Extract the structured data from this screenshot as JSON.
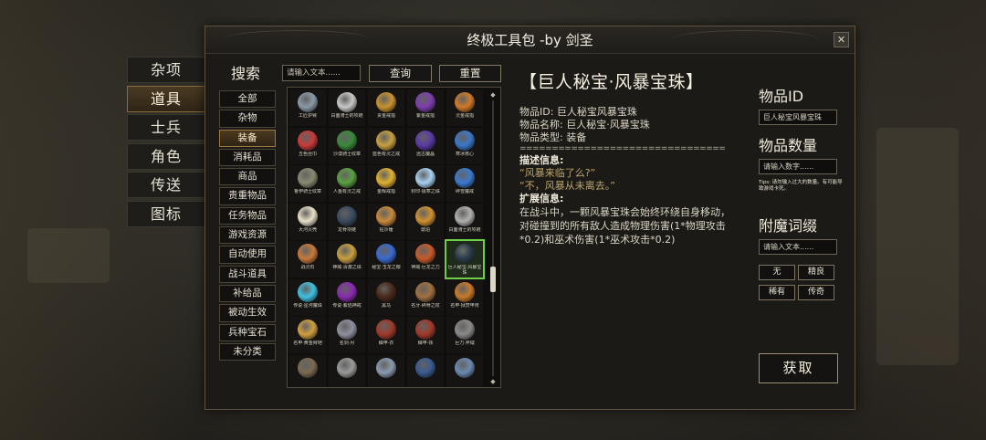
{
  "window": {
    "title": "终极工具包 -by 剑圣",
    "close": "✕"
  },
  "sidemenu": [
    {
      "label": "杂项",
      "active": false
    },
    {
      "label": "道具",
      "active": true
    },
    {
      "label": "士兵",
      "active": false
    },
    {
      "label": "角色",
      "active": false
    },
    {
      "label": "传送",
      "active": false
    },
    {
      "label": "图标",
      "active": false
    }
  ],
  "search": {
    "title": "搜索",
    "placeholder": "请输入文本......",
    "query_label": "查询",
    "reset_label": "重置"
  },
  "categories": [
    {
      "label": "全部",
      "active": false
    },
    {
      "label": "杂物",
      "active": false
    },
    {
      "label": "装备",
      "active": true
    },
    {
      "label": "消耗品",
      "active": false
    },
    {
      "label": "商品",
      "active": false
    },
    {
      "label": "贵重物品",
      "active": false
    },
    {
      "label": "任务物品",
      "active": false
    },
    {
      "label": "游戏资源",
      "active": false
    },
    {
      "label": "自动使用",
      "active": false
    },
    {
      "label": "战斗道具",
      "active": false
    },
    {
      "label": "补给品",
      "active": false
    },
    {
      "label": "被动生效",
      "active": false
    },
    {
      "label": "兵种宝石",
      "active": false
    },
    {
      "label": "未分类",
      "active": false
    }
  ],
  "items": [
    {
      "name": "工匠护臂",
      "color": "#8a9aa8"
    },
    {
      "name": "白面骑士的项链",
      "color": "#c8c8c8"
    },
    {
      "name": "贵金戒指",
      "color": "#c8932e"
    },
    {
      "name": "紫金戒指",
      "color": "#7d3fb0"
    },
    {
      "name": "灵金戒指",
      "color": "#d07a2a"
    },
    {
      "name": "五色丝巾",
      "color": "#c83a3a"
    },
    {
      "name": "沙漠骑士纹章",
      "color": "#3a8a3a"
    },
    {
      "name": "蓝色有灵之戒",
      "color": "#c8a040"
    },
    {
      "name": "远古魔晶",
      "color": "#5a3aa8"
    },
    {
      "name": "寒冰核心",
      "color": "#3a78c8"
    },
    {
      "name": "鲁伊骑士纹章",
      "color": "#8a8a70"
    },
    {
      "name": "人鱼有灵之戒",
      "color": "#5aa040"
    },
    {
      "name": "金辉戒指",
      "color": "#e0b030"
    },
    {
      "name": "封印·极寒之珠",
      "color": "#a8d0f0"
    },
    {
      "name": "碎雪魔戒",
      "color": "#3a7ad0"
    },
    {
      "name": "大河贝壳",
      "color": "#e8e0c8"
    },
    {
      "name": "龙骨项链",
      "color": "#3a4a60"
    },
    {
      "name": "钻沙锤",
      "color": "#c88a3a"
    },
    {
      "name": "琥珀",
      "color": "#d09030"
    },
    {
      "name": "白面骑士的项链",
      "color": "#b0b0b0"
    },
    {
      "name": "战灵石",
      "color": "#c87a3a"
    },
    {
      "name": "神威·清澈之珠",
      "color": "#c8a040"
    },
    {
      "name": "秘宝·玉龙之眼",
      "color": "#3a6ad0"
    },
    {
      "name": "神威·巨龙之力",
      "color": "#c85a2a"
    },
    {
      "name": "巨人秘宝·风暴宝珠",
      "color": "#2a3a4a"
    },
    {
      "name": "传说·星河魔珠",
      "color": "#40c0e0"
    },
    {
      "name": "传说·紫焰神戒",
      "color": "#8a2ab0"
    },
    {
      "name": "黑马",
      "color": "#4a2a1a"
    },
    {
      "name": "名牙·碎骨之杖",
      "color": "#a07040"
    },
    {
      "name": "名甲·狱焚甲胄",
      "color": "#c87a2a"
    },
    {
      "name": "名甲·黄金臂铠",
      "color": "#d0a040"
    },
    {
      "name": "名剑·月",
      "color": "#9090a0"
    },
    {
      "name": "鳞甲·衣",
      "color": "#a03a2a"
    },
    {
      "name": "鳞甲·领",
      "color": "#a03a2a"
    },
    {
      "name": "巨力·斧钺",
      "color": "#8a8a8a"
    },
    {
      "name": "",
      "color": "#7a6a50"
    },
    {
      "name": "",
      "color": "#9a9a9a"
    },
    {
      "name": "",
      "color": "#8a9ab0"
    },
    {
      "name": "",
      "color": "#3a5a90"
    },
    {
      "name": "",
      "color": "#6a8ab0"
    }
  ],
  "detail": {
    "title": "【巨人秘宝·风暴宝珠】",
    "id_line": "物品ID: 巨人秘宝风暴宝珠",
    "name_line": "物品名称: 巨人秘宝·风暴宝珠",
    "type_line": "物品类型: 装备",
    "separator": "================================",
    "desc_title": "描述信息:",
    "desc_lines": [
      "“风暴来临了么?”",
      "“不，风暴从未离去。”"
    ],
    "ext_title": "扩展信息:",
    "ext_text": "在战斗中，一颗风暴宝珠会始终环绕自身移动，对碰撞到的所有敌人造成物理伤害(1*物理攻击*0.2)和巫术伤害(1*巫术攻击*0.2)"
  },
  "right": {
    "id_label": "物品ID",
    "id_value": "巨人秘宝风暴宝珠",
    "qty_label": "物品数量",
    "qty_placeholder": "请输入数字......",
    "tips": "Tips: 请勿输入过大的数量。有可能导致游戏卡死。",
    "enchant_label": "附魔词缀",
    "enchant_placeholder": "请输入文本......",
    "quality": [
      "无",
      "精良",
      "稀有",
      "传奇"
    ],
    "get_label": "获取"
  }
}
